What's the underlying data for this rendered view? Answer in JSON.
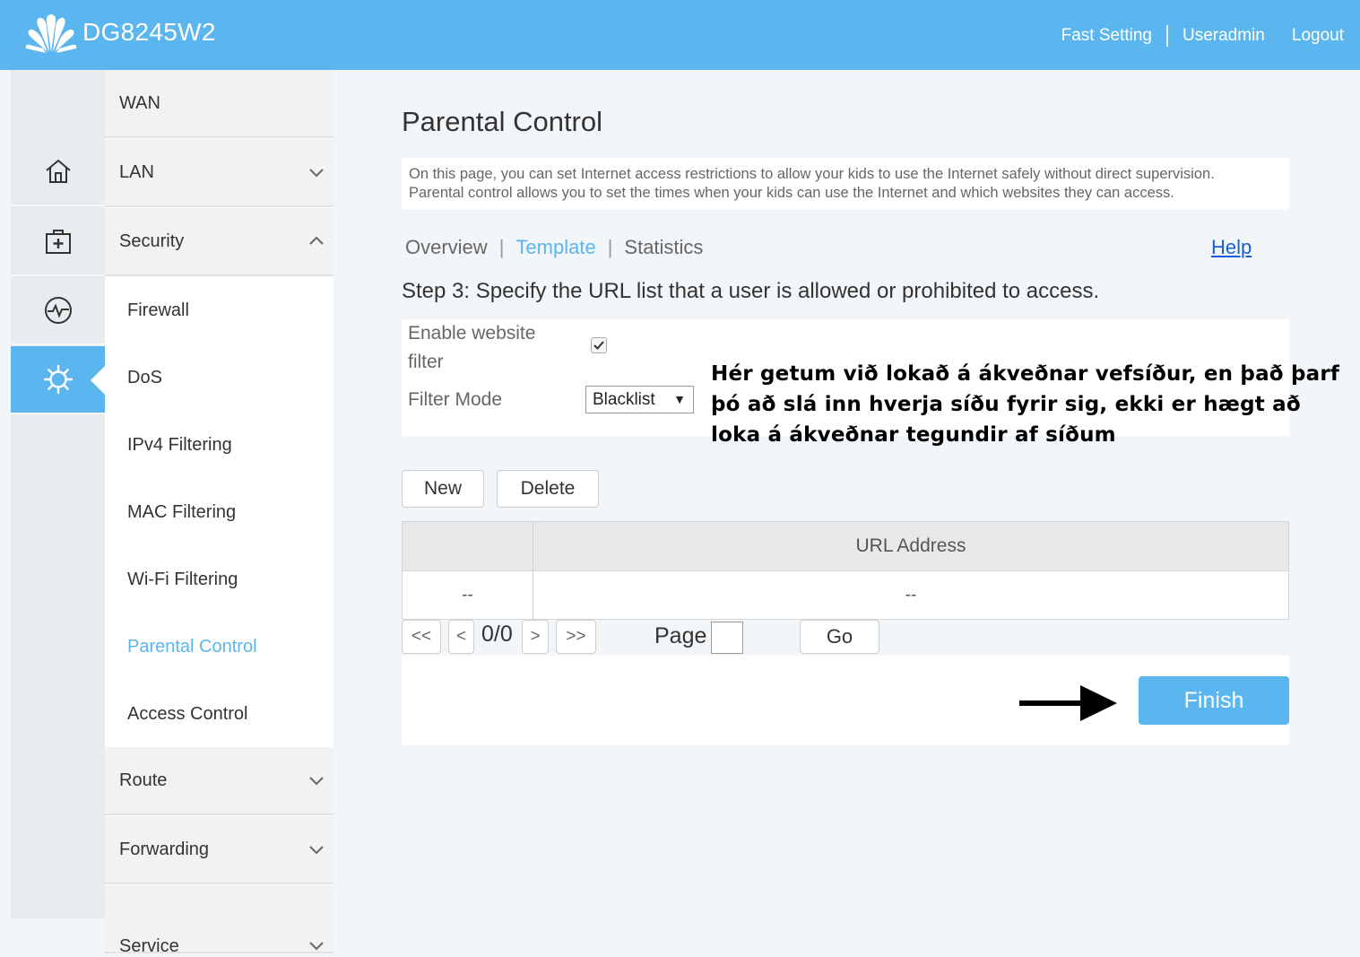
{
  "header": {
    "brand": "DG8245W2",
    "links": [
      "Fast Setting",
      "Useradmin",
      "Logout"
    ],
    "bg_color": "#5bb6ef"
  },
  "icon_rail": [
    {
      "icon": "home-icon"
    },
    {
      "icon": "medical-kit-icon"
    },
    {
      "icon": "pulse-icon"
    },
    {
      "icon": "gear-icon",
      "active": true
    }
  ],
  "menu": {
    "sections": [
      "WAN",
      "LAN",
      "Security",
      "Route",
      "Forwarding",
      "Service"
    ],
    "security_items": [
      "Firewall",
      "DoS",
      "IPv4 Filtering",
      "MAC Filtering",
      "Wi-Fi Filtering",
      "Parental Control",
      "Access Control"
    ],
    "active_item": "Parental Control"
  },
  "page": {
    "title": "Parental Control",
    "description_line1": "On this page, you can set Internet access restrictions to allow your kids to use the Internet safely without direct supervision.",
    "description_line2": "Parental control allows you to set the times when your kids can use the Internet and which websites they can access.",
    "tabs": [
      "Overview",
      "Template",
      "Statistics"
    ],
    "active_tab": "Template",
    "help": "Help",
    "step": "Step 3: Specify the URL list that a user is allowed or prohibited to access."
  },
  "form": {
    "enable_label_line1": "Enable website",
    "enable_label_line2": "filter",
    "enable_checked": true,
    "check_glyph": "✔",
    "filter_mode_label": "Filter Mode",
    "filter_mode_value": "Blacklist",
    "select_arrow": "▼"
  },
  "annotation": "Hér getum við lokað á ákveðnar vefsíður, en það þarf þó að slá inn hverja síðu fyrir sig, ekki er hægt að loka á ákveðnar tegundir af síðum",
  "buttons": {
    "new": "New",
    "delete": "Delete",
    "go": "Go",
    "finish": "Finish"
  },
  "table": {
    "columns": [
      "",
      "URL Address"
    ],
    "rows": [
      [
        "--",
        "--"
      ]
    ]
  },
  "pager": {
    "first": "<<",
    "prev": "<",
    "count": "0/0",
    "next": ">",
    "last": ">>",
    "page_label": "Page",
    "page_value": ""
  }
}
